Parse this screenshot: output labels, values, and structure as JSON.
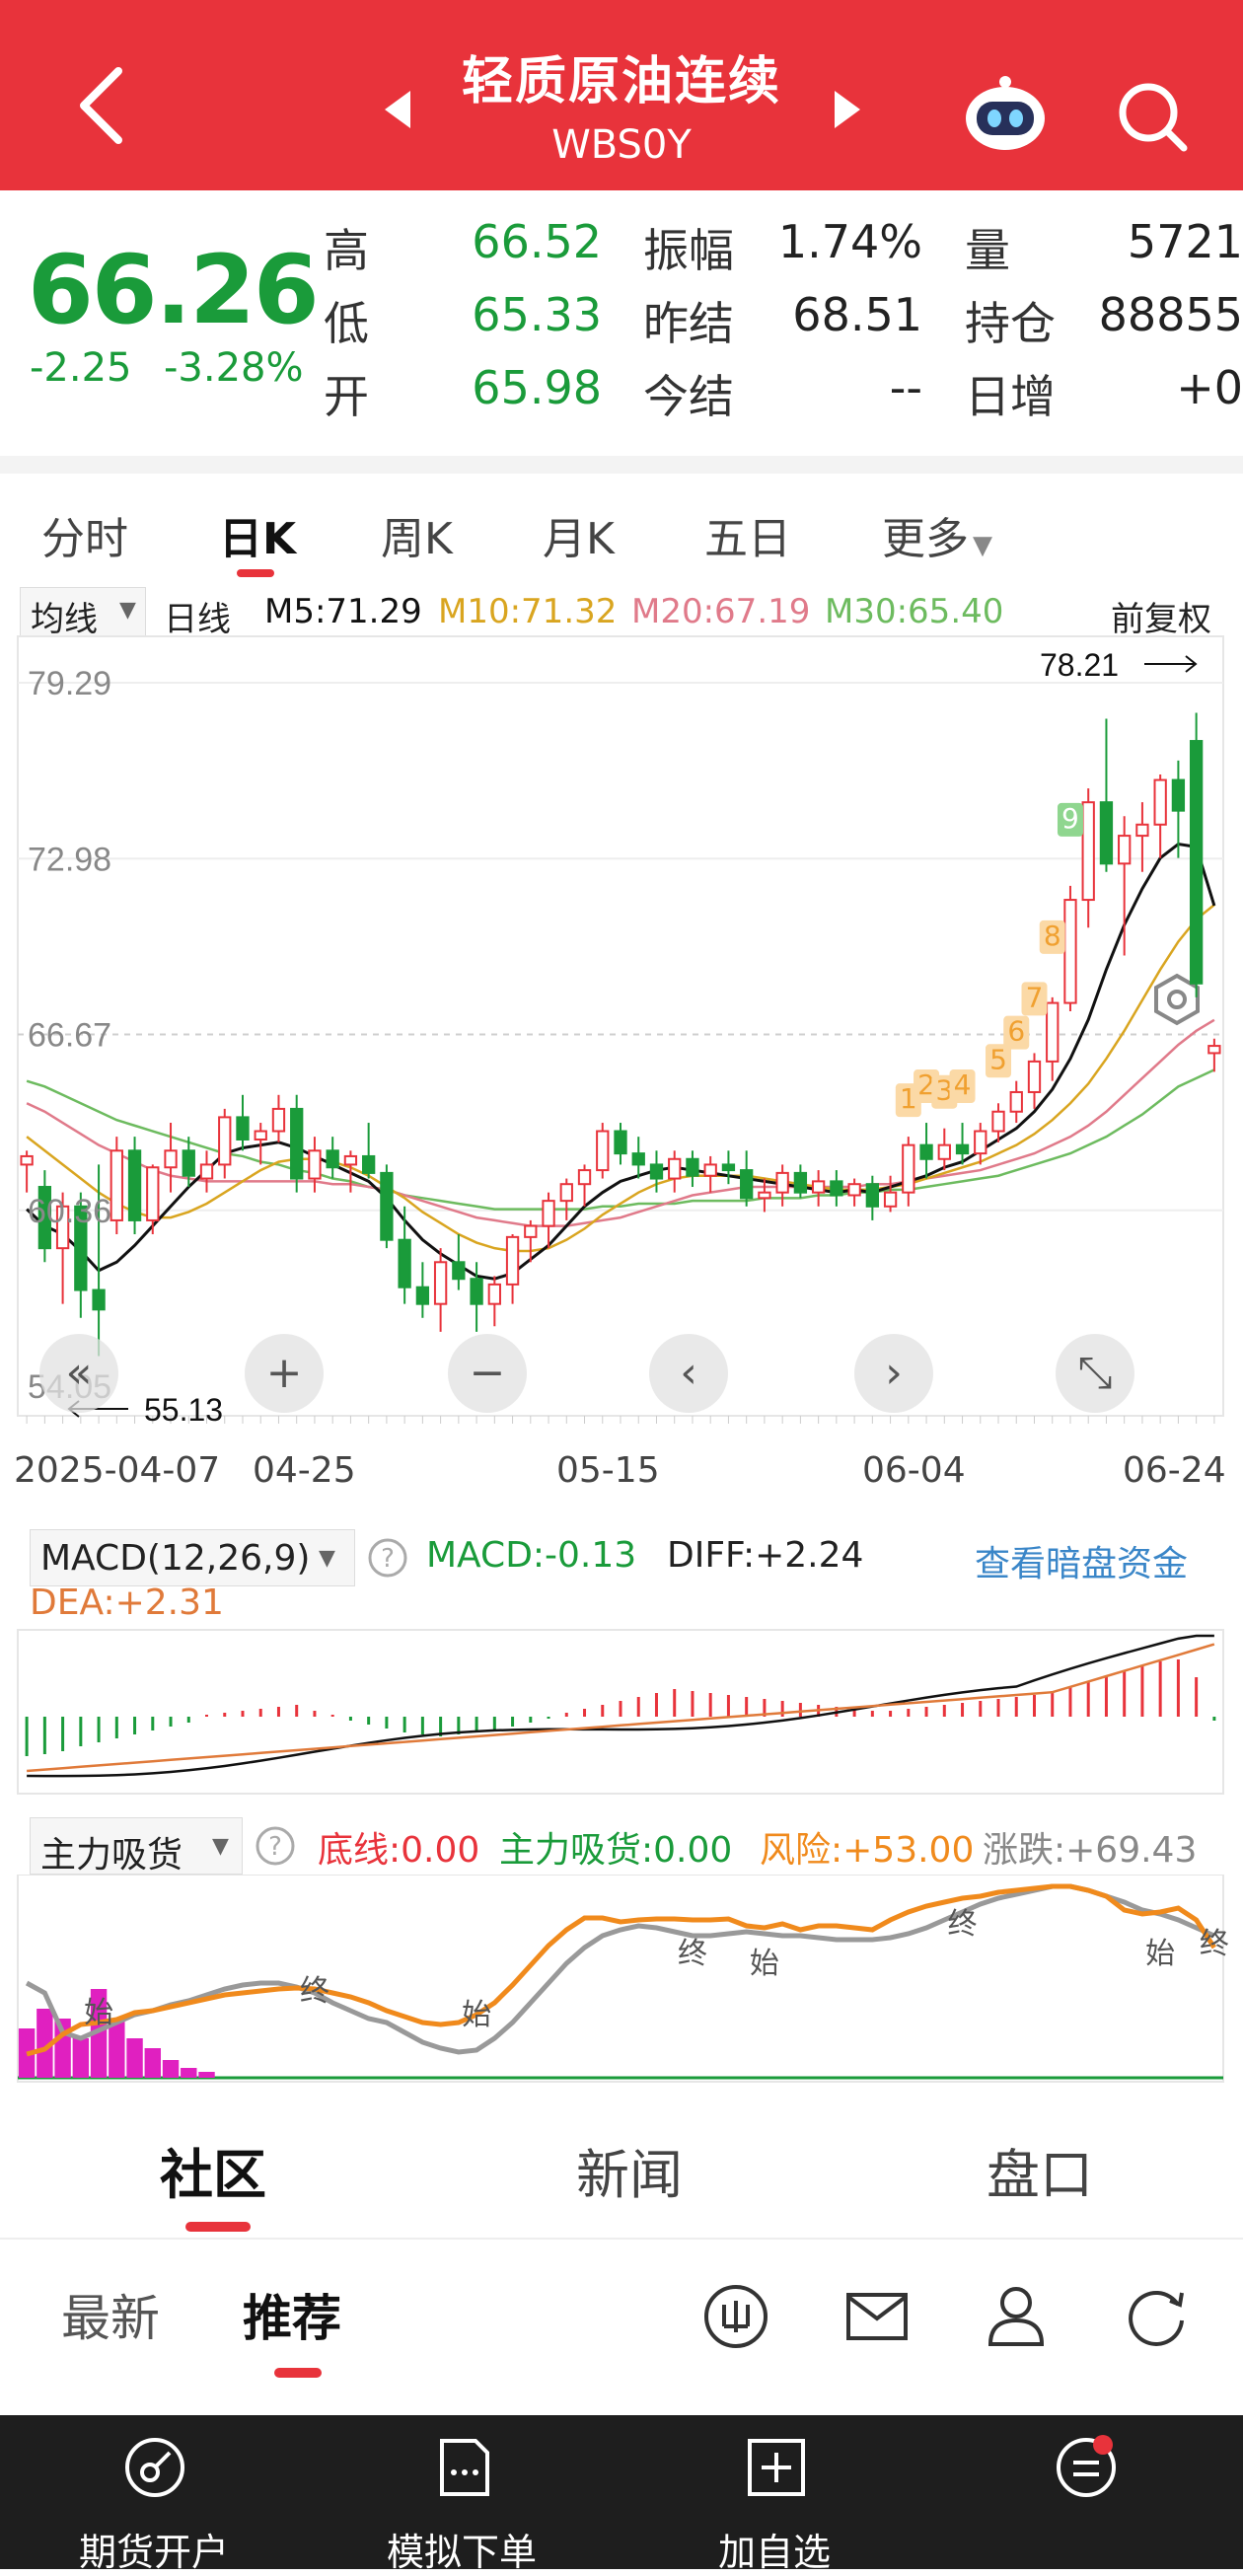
{
  "header": {
    "title": "轻质原油连续",
    "code": "WBS0Y"
  },
  "quote": {
    "price": "66.26",
    "change": "-2.25",
    "change_pct": "-3.28%",
    "rows": [
      {
        "l1": "高",
        "v1": "66.52",
        "l2": "振幅",
        "v2": "1.74%",
        "l3": "量",
        "v3": "5721"
      },
      {
        "l1": "低",
        "v1": "65.33",
        "l2": "昨结",
        "v2": "68.51",
        "l3": "持仓",
        "v3": "88855"
      },
      {
        "l1": "开",
        "v1": "65.98",
        "l2": "今结",
        "v2": "--",
        "l3": "日增",
        "v3": "+0"
      }
    ]
  },
  "period_tabs": [
    "分时",
    "日K",
    "周K",
    "月K",
    "五日",
    "更多"
  ],
  "active_tab": "日K",
  "ma_bar": {
    "selector": "均线",
    "type": "日线",
    "m5": "M5:71.29",
    "m10": "M10:71.32",
    "m20": "M20:67.19",
    "m30": "M30:65.40",
    "adjust": "前复权"
  },
  "colors": {
    "red": "#e8333b",
    "green": "#1a9b3a",
    "m5": "#111111",
    "m10": "#d9a520",
    "m20": "#e07a8a",
    "m30": "#6dbb5f",
    "accent_blue": "#3a86c8",
    "orange": "#f08a1c"
  },
  "chart_data": [
    {
      "type": "candlestick",
      "y_ticks": [
        "79.29",
        "72.98",
        "66.67",
        "60.36",
        "54.05"
      ],
      "x_ticks": [
        "2025-04-07",
        "04-25",
        "05-15",
        "06-04",
        "06-24"
      ],
      "max_label": "78.21",
      "min_label": "55.13",
      "ylim": [
        54.05,
        79.29
      ],
      "td_labels": [
        "1",
        "2",
        "3",
        "4",
        "5",
        "6",
        "7",
        "8",
        "9"
      ],
      "candles": [
        [
          62.0,
          62.5,
          61.0,
          62.3
        ],
        [
          61.2,
          61.8,
          58.5,
          59.0
        ],
        [
          59.0,
          61.0,
          57.0,
          60.5
        ],
        [
          60.5,
          61.0,
          56.5,
          57.5
        ],
        [
          57.5,
          62.0,
          55.13,
          56.8
        ],
        [
          60.0,
          63.0,
          59.5,
          62.5
        ],
        [
          62.5,
          63.0,
          59.5,
          60.0
        ],
        [
          60.0,
          62.0,
          59.5,
          61.9
        ],
        [
          61.9,
          63.5,
          61.0,
          62.5
        ],
        [
          62.5,
          63.0,
          61.2,
          61.6
        ],
        [
          61.5,
          62.5,
          61.0,
          62.0
        ],
        [
          62.0,
          64.0,
          61.5,
          63.7
        ],
        [
          63.7,
          64.5,
          62.5,
          62.9
        ],
        [
          62.9,
          63.5,
          62.0,
          63.2
        ],
        [
          63.2,
          64.5,
          62.8,
          64.0
        ],
        [
          64.0,
          64.5,
          61.0,
          61.5
        ],
        [
          61.5,
          63.0,
          61.0,
          62.5
        ],
        [
          62.5,
          63.0,
          61.5,
          61.9
        ],
        [
          62.0,
          62.5,
          61.0,
          62.3
        ],
        [
          62.3,
          63.5,
          61.5,
          61.7
        ],
        [
          61.7,
          62.0,
          59.0,
          59.3
        ],
        [
          59.3,
          60.5,
          57.0,
          57.6
        ],
        [
          57.6,
          58.5,
          56.5,
          57.0
        ],
        [
          57.0,
          59.0,
          56.0,
          58.5
        ],
        [
          58.5,
          59.5,
          57.5,
          57.9
        ],
        [
          57.9,
          58.5,
          56.0,
          57.0
        ],
        [
          57.0,
          58.0,
          56.2,
          57.7
        ],
        [
          57.7,
          59.5,
          57.0,
          59.4
        ],
        [
          59.4,
          60.0,
          58.5,
          59.8
        ],
        [
          59.8,
          61.0,
          59.0,
          60.7
        ],
        [
          60.7,
          61.5,
          60.0,
          61.3
        ],
        [
          61.3,
          62.0,
          60.5,
          61.8
        ],
        [
          61.8,
          63.5,
          61.5,
          63.2
        ],
        [
          63.2,
          63.5,
          62.0,
          62.4
        ],
        [
          62.4,
          63.0,
          61.5,
          62.0
        ],
        [
          62.0,
          62.5,
          61.0,
          61.5
        ],
        [
          61.5,
          62.5,
          61.0,
          62.2
        ],
        [
          62.2,
          62.5,
          61.2,
          61.6
        ],
        [
          61.6,
          62.3,
          61.0,
          62.0
        ],
        [
          62.0,
          62.5,
          61.3,
          61.8
        ],
        [
          61.8,
          62.5,
          60.5,
          60.8
        ],
        [
          60.8,
          61.5,
          60.3,
          61.0
        ],
        [
          61.0,
          62.0,
          60.5,
          61.7
        ],
        [
          61.7,
          62.0,
          60.8,
          61.0
        ],
        [
          61.0,
          61.8,
          60.5,
          61.4
        ],
        [
          61.4,
          61.8,
          60.5,
          60.9
        ],
        [
          60.9,
          61.5,
          60.5,
          61.3
        ],
        [
          61.3,
          61.6,
          60.0,
          60.5
        ],
        [
          60.5,
          61.6,
          60.3,
          61.0
        ],
        [
          61.0,
          63.0,
          60.5,
          62.7
        ],
        [
          62.7,
          63.5,
          61.5,
          62.2
        ],
        [
          62.2,
          63.3,
          61.8,
          62.7
        ],
        [
          62.7,
          63.5,
          62.0,
          62.4
        ],
        [
          62.4,
          63.5,
          62.0,
          63.2
        ],
        [
          63.2,
          64.2,
          62.8,
          63.9
        ],
        [
          63.9,
          65.0,
          63.5,
          64.6
        ],
        [
          64.6,
          66.0,
          64.0,
          65.7
        ],
        [
          65.7,
          68.0,
          65.0,
          67.8
        ],
        [
          67.8,
          72.0,
          67.5,
          71.5
        ],
        [
          71.5,
          75.5,
          70.5,
          75.0
        ],
        [
          75.0,
          78.0,
          72.5,
          72.8
        ],
        [
          72.8,
          74.5,
          69.5,
          73.8
        ],
        [
          73.8,
          75.0,
          72.5,
          74.2
        ],
        [
          74.2,
          76.0,
          73.0,
          75.8
        ],
        [
          75.8,
          76.5,
          73.0,
          74.7
        ],
        [
          77.2,
          78.21,
          68.0,
          68.5
        ],
        [
          66.0,
          66.52,
          65.33,
          66.26
        ]
      ],
      "ma5": [
        60.4,
        59.8,
        59.5,
        58.9,
        58.2,
        58.5,
        59.1,
        59.8,
        60.5,
        61.2,
        61.8,
        62.4,
        62.6,
        62.7,
        62.8,
        62.6,
        62.3,
        62.0,
        61.7,
        61.4,
        60.8,
        60.0,
        59.3,
        58.8,
        58.4,
        58.0,
        57.9,
        58.1,
        58.6,
        59.1,
        59.8,
        60.5,
        61.0,
        61.4,
        61.6,
        61.8,
        61.9,
        61.8,
        61.7,
        61.6,
        61.5,
        61.4,
        61.3,
        61.2,
        61.1,
        61.0,
        61.1,
        61.0,
        61.2,
        61.4,
        61.6,
        61.9,
        62.1,
        62.5,
        62.9,
        63.3,
        63.9,
        64.7,
        65.8,
        67.2,
        69.0,
        70.6,
        71.9,
        73.0,
        73.5,
        73.4,
        71.29
      ],
      "ma10": [
        63.0,
        62.5,
        62.0,
        61.5,
        61.0,
        60.6,
        60.3,
        60.1,
        60.1,
        60.3,
        60.6,
        61.0,
        61.4,
        61.8,
        62.1,
        62.2,
        62.2,
        62.1,
        61.9,
        61.6,
        61.2,
        60.8,
        60.3,
        59.9,
        59.5,
        59.2,
        59.0,
        58.9,
        58.9,
        59.0,
        59.3,
        59.7,
        60.2,
        60.6,
        61.0,
        61.3,
        61.5,
        61.6,
        61.6,
        61.6,
        61.6,
        61.5,
        61.4,
        61.3,
        61.2,
        61.1,
        61.1,
        61.1,
        61.2,
        61.3,
        61.5,
        61.7,
        61.9,
        62.1,
        62.4,
        62.7,
        63.1,
        63.6,
        64.2,
        64.9,
        65.8,
        66.8,
        67.9,
        69.0,
        70.0,
        70.8,
        71.32
      ],
      "ma20": [
        64.2,
        63.9,
        63.5,
        63.1,
        62.7,
        62.4,
        62.1,
        61.8,
        61.6,
        61.5,
        61.4,
        61.4,
        61.4,
        61.4,
        61.4,
        61.4,
        61.4,
        61.3,
        61.3,
        61.2,
        61.1,
        60.9,
        60.7,
        60.5,
        60.3,
        60.1,
        60.0,
        59.9,
        59.8,
        59.8,
        59.8,
        59.9,
        60.0,
        60.1,
        60.3,
        60.5,
        60.7,
        60.9,
        61.0,
        61.1,
        61.2,
        61.2,
        61.2,
        61.2,
        61.2,
        61.2,
        61.2,
        61.3,
        61.3,
        61.4,
        61.5,
        61.6,
        61.7,
        61.8,
        62.0,
        62.2,
        62.4,
        62.7,
        63.0,
        63.4,
        63.9,
        64.5,
        65.1,
        65.7,
        66.3,
        66.8,
        67.19
      ],
      "ma30": [
        65.0,
        64.8,
        64.5,
        64.2,
        63.9,
        63.6,
        63.4,
        63.2,
        63.0,
        62.8,
        62.6,
        62.4,
        62.3,
        62.1,
        62.0,
        61.8,
        61.7,
        61.5,
        61.4,
        61.2,
        61.1,
        60.9,
        60.8,
        60.7,
        60.6,
        60.5,
        60.4,
        60.4,
        60.4,
        60.4,
        60.4,
        60.4,
        60.5,
        60.5,
        60.6,
        60.6,
        60.6,
        60.7,
        60.7,
        60.7,
        60.7,
        60.8,
        60.8,
        60.8,
        60.9,
        60.9,
        61.0,
        61.0,
        61.1,
        61.1,
        61.2,
        61.3,
        61.4,
        61.5,
        61.6,
        61.8,
        62.0,
        62.2,
        62.4,
        62.7,
        63.0,
        63.4,
        63.8,
        64.3,
        64.8,
        65.1,
        65.4
      ]
    },
    {
      "type": "macd",
      "indicator": "MACD(12,26,9)",
      "macd": "MACD:-0.13",
      "diff": "DIFF:+2.24",
      "dea": "DEA:+2.31",
      "link": "查看暗盘资金"
    },
    {
      "type": "indicator",
      "indicator": "主力吸货",
      "bottom": "底线:0.00",
      "absorb": "主力吸货:0.00",
      "risk": "风险:+53.00",
      "rise": "涨跌:+69.43",
      "markers": [
        "始",
        "终",
        "始",
        "终",
        "始",
        "终",
        "始",
        "终"
      ]
    }
  ],
  "nav_buttons": [
    "«",
    "+",
    "−",
    "‹",
    "›"
  ],
  "bottom_tabs": [
    "社区",
    "新闻",
    "盘口"
  ],
  "sub_tabs": [
    "最新",
    "推荐"
  ],
  "footer": [
    "期货开户",
    "模拟下单",
    "加自选"
  ]
}
